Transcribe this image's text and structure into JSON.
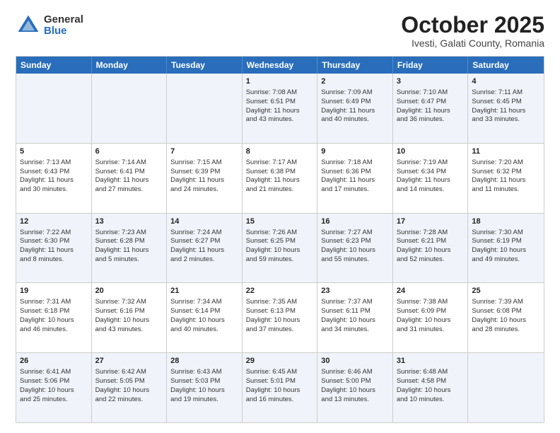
{
  "logo": {
    "general": "General",
    "blue": "Blue"
  },
  "title": "October 2025",
  "subtitle": "Ivesti, Galati County, Romania",
  "header_days": [
    "Sunday",
    "Monday",
    "Tuesday",
    "Wednesday",
    "Thursday",
    "Friday",
    "Saturday"
  ],
  "rows": [
    [
      {
        "day": "",
        "lines": []
      },
      {
        "day": "",
        "lines": []
      },
      {
        "day": "",
        "lines": []
      },
      {
        "day": "1",
        "lines": [
          "Sunrise: 7:08 AM",
          "Sunset: 6:51 PM",
          "Daylight: 11 hours",
          "and 43 minutes."
        ]
      },
      {
        "day": "2",
        "lines": [
          "Sunrise: 7:09 AM",
          "Sunset: 6:49 PM",
          "Daylight: 11 hours",
          "and 40 minutes."
        ]
      },
      {
        "day": "3",
        "lines": [
          "Sunrise: 7:10 AM",
          "Sunset: 6:47 PM",
          "Daylight: 11 hours",
          "and 36 minutes."
        ]
      },
      {
        "day": "4",
        "lines": [
          "Sunrise: 7:11 AM",
          "Sunset: 6:45 PM",
          "Daylight: 11 hours",
          "and 33 minutes."
        ]
      }
    ],
    [
      {
        "day": "5",
        "lines": [
          "Sunrise: 7:13 AM",
          "Sunset: 6:43 PM",
          "Daylight: 11 hours",
          "and 30 minutes."
        ]
      },
      {
        "day": "6",
        "lines": [
          "Sunrise: 7:14 AM",
          "Sunset: 6:41 PM",
          "Daylight: 11 hours",
          "and 27 minutes."
        ]
      },
      {
        "day": "7",
        "lines": [
          "Sunrise: 7:15 AM",
          "Sunset: 6:39 PM",
          "Daylight: 11 hours",
          "and 24 minutes."
        ]
      },
      {
        "day": "8",
        "lines": [
          "Sunrise: 7:17 AM",
          "Sunset: 6:38 PM",
          "Daylight: 11 hours",
          "and 21 minutes."
        ]
      },
      {
        "day": "9",
        "lines": [
          "Sunrise: 7:18 AM",
          "Sunset: 6:36 PM",
          "Daylight: 11 hours",
          "and 17 minutes."
        ]
      },
      {
        "day": "10",
        "lines": [
          "Sunrise: 7:19 AM",
          "Sunset: 6:34 PM",
          "Daylight: 11 hours",
          "and 14 minutes."
        ]
      },
      {
        "day": "11",
        "lines": [
          "Sunrise: 7:20 AM",
          "Sunset: 6:32 PM",
          "Daylight: 11 hours",
          "and 11 minutes."
        ]
      }
    ],
    [
      {
        "day": "12",
        "lines": [
          "Sunrise: 7:22 AM",
          "Sunset: 6:30 PM",
          "Daylight: 11 hours",
          "and 8 minutes."
        ]
      },
      {
        "day": "13",
        "lines": [
          "Sunrise: 7:23 AM",
          "Sunset: 6:28 PM",
          "Daylight: 11 hours",
          "and 5 minutes."
        ]
      },
      {
        "day": "14",
        "lines": [
          "Sunrise: 7:24 AM",
          "Sunset: 6:27 PM",
          "Daylight: 11 hours",
          "and 2 minutes."
        ]
      },
      {
        "day": "15",
        "lines": [
          "Sunrise: 7:26 AM",
          "Sunset: 6:25 PM",
          "Daylight: 10 hours",
          "and 59 minutes."
        ]
      },
      {
        "day": "16",
        "lines": [
          "Sunrise: 7:27 AM",
          "Sunset: 6:23 PM",
          "Daylight: 10 hours",
          "and 55 minutes."
        ]
      },
      {
        "day": "17",
        "lines": [
          "Sunrise: 7:28 AM",
          "Sunset: 6:21 PM",
          "Daylight: 10 hours",
          "and 52 minutes."
        ]
      },
      {
        "day": "18",
        "lines": [
          "Sunrise: 7:30 AM",
          "Sunset: 6:19 PM",
          "Daylight: 10 hours",
          "and 49 minutes."
        ]
      }
    ],
    [
      {
        "day": "19",
        "lines": [
          "Sunrise: 7:31 AM",
          "Sunset: 6:18 PM",
          "Daylight: 10 hours",
          "and 46 minutes."
        ]
      },
      {
        "day": "20",
        "lines": [
          "Sunrise: 7:32 AM",
          "Sunset: 6:16 PM",
          "Daylight: 10 hours",
          "and 43 minutes."
        ]
      },
      {
        "day": "21",
        "lines": [
          "Sunrise: 7:34 AM",
          "Sunset: 6:14 PM",
          "Daylight: 10 hours",
          "and 40 minutes."
        ]
      },
      {
        "day": "22",
        "lines": [
          "Sunrise: 7:35 AM",
          "Sunset: 6:13 PM",
          "Daylight: 10 hours",
          "and 37 minutes."
        ]
      },
      {
        "day": "23",
        "lines": [
          "Sunrise: 7:37 AM",
          "Sunset: 6:11 PM",
          "Daylight: 10 hours",
          "and 34 minutes."
        ]
      },
      {
        "day": "24",
        "lines": [
          "Sunrise: 7:38 AM",
          "Sunset: 6:09 PM",
          "Daylight: 10 hours",
          "and 31 minutes."
        ]
      },
      {
        "day": "25",
        "lines": [
          "Sunrise: 7:39 AM",
          "Sunset: 6:08 PM",
          "Daylight: 10 hours",
          "and 28 minutes."
        ]
      }
    ],
    [
      {
        "day": "26",
        "lines": [
          "Sunrise: 6:41 AM",
          "Sunset: 5:06 PM",
          "Daylight: 10 hours",
          "and 25 minutes."
        ]
      },
      {
        "day": "27",
        "lines": [
          "Sunrise: 6:42 AM",
          "Sunset: 5:05 PM",
          "Daylight: 10 hours",
          "and 22 minutes."
        ]
      },
      {
        "day": "28",
        "lines": [
          "Sunrise: 6:43 AM",
          "Sunset: 5:03 PM",
          "Daylight: 10 hours",
          "and 19 minutes."
        ]
      },
      {
        "day": "29",
        "lines": [
          "Sunrise: 6:45 AM",
          "Sunset: 5:01 PM",
          "Daylight: 10 hours",
          "and 16 minutes."
        ]
      },
      {
        "day": "30",
        "lines": [
          "Sunrise: 6:46 AM",
          "Sunset: 5:00 PM",
          "Daylight: 10 hours",
          "and 13 minutes."
        ]
      },
      {
        "day": "31",
        "lines": [
          "Sunrise: 6:48 AM",
          "Sunset: 4:58 PM",
          "Daylight: 10 hours",
          "and 10 minutes."
        ]
      },
      {
        "day": "",
        "lines": []
      }
    ]
  ],
  "alt_rows": [
    0,
    2,
    4
  ]
}
